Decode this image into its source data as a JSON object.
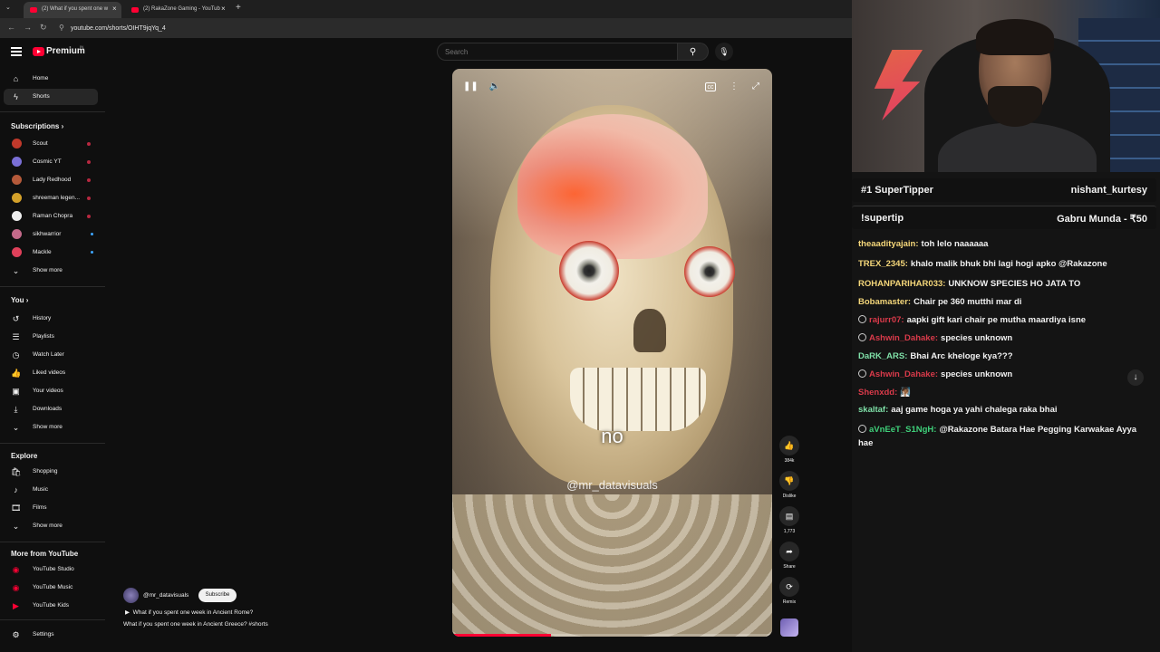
{
  "browser": {
    "tabs": [
      {
        "title": "(2) What if you spent one w"
      },
      {
        "title": "(2) RakaZone Gaming - YouTub"
      }
    ],
    "url": "youtube.com/shorts/OIHT9jqYq_4"
  },
  "header": {
    "logo_text": "Premium",
    "logo_sup": "IN",
    "search_placeholder": "Search"
  },
  "sidebar": {
    "main": [
      {
        "label": "Home",
        "icon": "home-icon"
      },
      {
        "label": "Shorts",
        "icon": "shorts-icon"
      }
    ],
    "subscriptions_heading": "Subscriptions",
    "subscriptions": [
      {
        "label": "Scout",
        "avatar_color": "#c0392b",
        "live": true
      },
      {
        "label": "Cosmic YT",
        "avatar_color": "#7a6fd6",
        "live": true
      },
      {
        "label": "Lady Redhood",
        "avatar_color": "#b55a3a",
        "live": true
      },
      {
        "label": "shreeman legen...",
        "avatar_color": "#d4a12a",
        "live": true
      },
      {
        "label": "Raman Chopra",
        "avatar_color": "#eeeeee",
        "live": true
      },
      {
        "label": "sikhwarrior",
        "avatar_color": "#c46a8a",
        "new": true
      },
      {
        "label": "Mackle",
        "avatar_color": "#e0405a",
        "new": true
      }
    ],
    "show_more": "Show more",
    "you_heading": "You",
    "you": [
      {
        "label": "History",
        "icon": "history-icon"
      },
      {
        "label": "Playlists",
        "icon": "playlists-icon"
      },
      {
        "label": "Watch Later",
        "icon": "watch-later-icon"
      },
      {
        "label": "Liked videos",
        "icon": "like-icon"
      },
      {
        "label": "Your videos",
        "icon": "your-videos-icon"
      },
      {
        "label": "Downloads",
        "icon": "download-icon"
      }
    ],
    "explore_heading": "Explore",
    "explore": [
      {
        "label": "Shopping",
        "icon": "shopping-icon"
      },
      {
        "label": "Music",
        "icon": "music-icon"
      },
      {
        "label": "Films",
        "icon": "films-icon"
      }
    ],
    "more_heading": "More from YouTube",
    "more": [
      {
        "label": "YouTube Studio"
      },
      {
        "label": "YouTube Music"
      },
      {
        "label": "YouTube Kids"
      }
    ],
    "settings": "Settings"
  },
  "player": {
    "caption": "no",
    "watermark": "@mr_datavisuals",
    "progress": 0.31
  },
  "actions": {
    "likes": "384k",
    "dislike": "Dislike",
    "comments": "1,773",
    "share": "Share",
    "remix": "Remix"
  },
  "video": {
    "channel": "@mr_datavisuals",
    "subscribe": "Subscribe",
    "title_next": "What if you spent one week in Ancient Rome?",
    "title_current": "What if you spent one week in Ancient Greece? #shorts"
  },
  "stream": {
    "banner1_left": "#1 SuperTipper",
    "banner1_right": "nishant_kurtesy",
    "banner2_left": "!supertip",
    "banner2_right": "Gabru Munda - ₹50",
    "chat": [
      {
        "user": "theaadityajain:",
        "color": "#f5d77a",
        "text": "toh lelo naaaaaa",
        "badge": false
      },
      {
        "user": "TREX_2345:",
        "color": "#f5d77a",
        "text": "khalo malik bhuk bhi lagi hogi apko @Rakazone",
        "badge": false
      },
      {
        "user": "ROHANPARIHAR033:",
        "color": "#f5d77a",
        "text": "UNKNOW SPECIES HO JATA TO",
        "badge": false
      },
      {
        "user": "Bobamaster:",
        "color": "#f5d77a",
        "text": "Chair pe 360 mutthi mar di",
        "badge": false
      },
      {
        "user": "rajurr07:",
        "color": "#d93a4a",
        "text": "aapki gift kari chair pe mutha maardiya isne",
        "badge": true
      },
      {
        "user": "Ashwin_Dahake:",
        "color": "#d93a4a",
        "text": "species unknown",
        "badge": true
      },
      {
        "user": "DaRK_ARS:",
        "color": "#7fe0a8",
        "text": "Bhai Arc kheloge kya???",
        "badge": false
      },
      {
        "user": "Ashwin_Dahake:",
        "color": "#d93a4a",
        "text": "species unknown",
        "badge": true
      },
      {
        "user": "Shenxdd:",
        "color": "#d93a4a",
        "text": "🧖🏾",
        "badge": false
      },
      {
        "user": "skaltaf:",
        "color": "#7fe0a8",
        "text": "aaj game hoga ya yahi chalega raka bhai",
        "badge": false
      },
      {
        "user": "aVnEeT_S1NgH:",
        "color": "#3fd07a",
        "text": "@Rakazone Batara Hae Pegging Karwakae Ayya hae",
        "badge": true
      }
    ]
  },
  "colors": {
    "accent": "#ff0033",
    "background": "#0f0f0f"
  }
}
